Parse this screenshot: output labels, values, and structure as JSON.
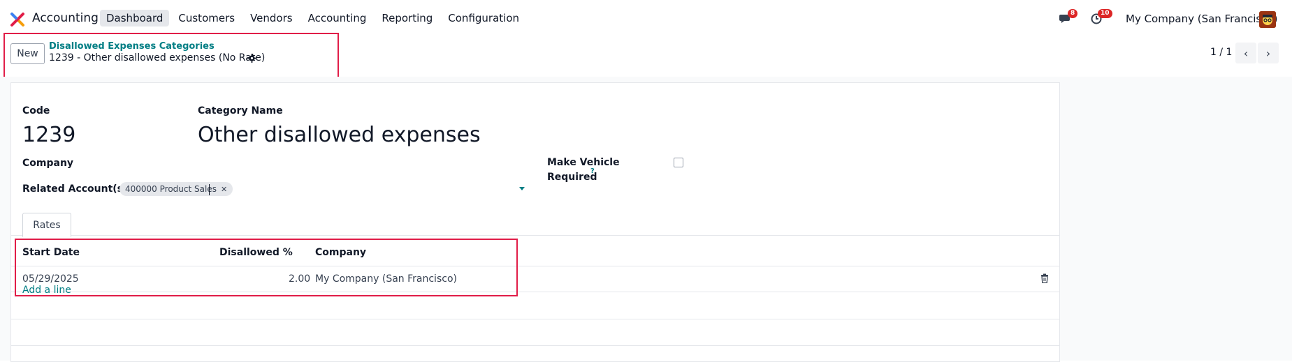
{
  "navbar": {
    "app_name": "Accounting",
    "menu": [
      "Dashboard",
      "Customers",
      "Vendors",
      "Accounting",
      "Reporting",
      "Configuration"
    ],
    "messages_count": "8",
    "activities_count": "10",
    "company": "My Company (San Francisco)"
  },
  "control_panel": {
    "new_label": "New",
    "breadcrumb_parent": "Disallowed Expenses Categories",
    "breadcrumb_current": "1239 - Other disallowed expenses (No Rate)",
    "pager": "1 / 1"
  },
  "form": {
    "code_label": "Code",
    "code_value": "1239",
    "name_label": "Category Name",
    "name_value": "Other disallowed expenses",
    "company_label": "Company",
    "vehicle_label_1": "Make Vehicle",
    "vehicle_label_2": "Required",
    "vehicle_help": "?",
    "accounts_label": "Related Account(s)",
    "account_tag": "400000 Product Sales",
    "tag_remove": "✕"
  },
  "tabs": [
    "Rates"
  ],
  "rates_table": {
    "headers": [
      "Start Date",
      "Disallowed %",
      "Company"
    ],
    "rows": [
      {
        "start_date": "05/29/2025",
        "rate": "2.00",
        "company": "My Company (San Francisco)"
      }
    ],
    "add_line": "Add a line"
  },
  "colors": {
    "accent": "#017e84",
    "highlight_box": "#e11d48",
    "badge": "#dc2626"
  }
}
